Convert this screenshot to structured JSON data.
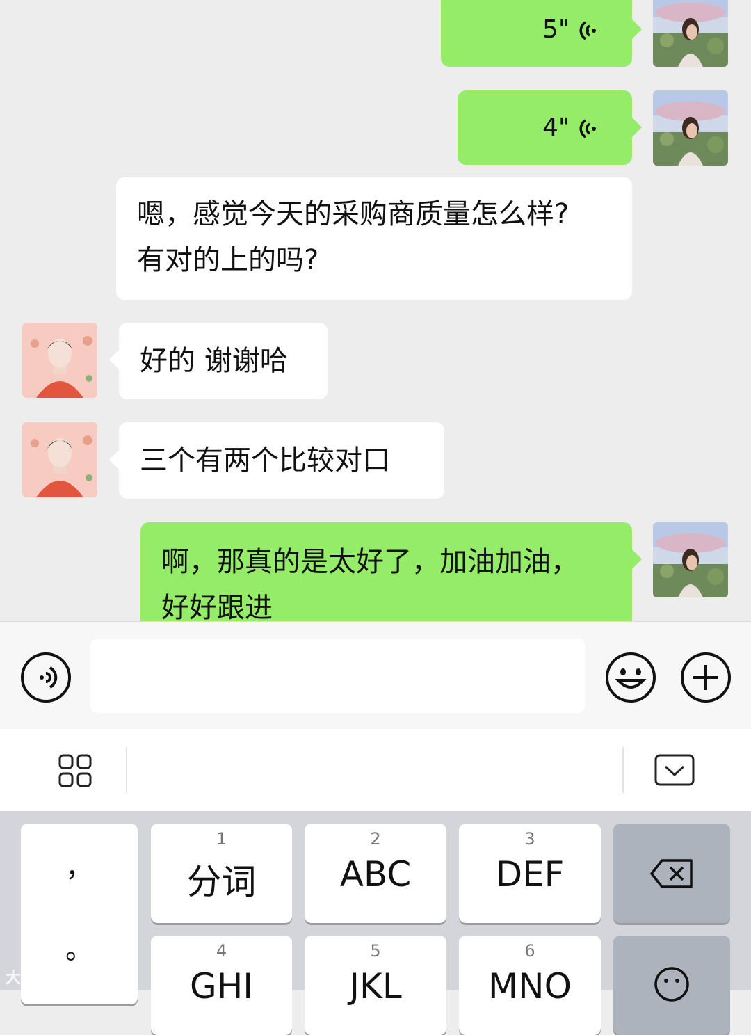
{
  "chat": {
    "messages": [
      {
        "type": "voice",
        "side": "out",
        "duration": "5\""
      },
      {
        "type": "voice",
        "side": "out",
        "duration": "4\""
      },
      {
        "type": "text",
        "side": "out",
        "lines": [
          "嗯，感觉今天的采购商质量怎么样?",
          "有对的上的吗?"
        ]
      },
      {
        "type": "text",
        "side": "in",
        "lines": [
          "好的 谢谢哈"
        ]
      },
      {
        "type": "text",
        "side": "in",
        "lines": [
          "三个有两个比较对口"
        ]
      },
      {
        "type": "text",
        "side": "out",
        "lines": [
          "啊，那真的是太好了，加油加油，",
          "好好跟进"
        ]
      }
    ]
  },
  "input_bar": {
    "voice_button": "voice-icon",
    "text_value": "",
    "emoji_button": "emoji-icon",
    "add_button": "plus-icon"
  },
  "ime_toolbar": {
    "left_icon": "grid-icon",
    "right_icon": "keyboard-hide-icon"
  },
  "keyboard": {
    "punct_top": "，",
    "punct_bottom": "。",
    "row1": [
      {
        "num": "1",
        "label": "分词"
      },
      {
        "num": "2",
        "label": "ABC"
      },
      {
        "num": "3",
        "label": "DEF"
      }
    ],
    "row2": [
      {
        "num": "4",
        "label": "GHI"
      },
      {
        "num": "5",
        "label": "JKL"
      },
      {
        "num": "6",
        "label": "MNO"
      }
    ],
    "backspace_icon": "backspace-icon",
    "emoji_key_icon": "emoji-icon"
  },
  "watermark": "大数跨境",
  "colors": {
    "outgoing_bubble": "#95ec69",
    "incoming_bubble": "#ffffff",
    "chat_bg": "#ededed"
  }
}
